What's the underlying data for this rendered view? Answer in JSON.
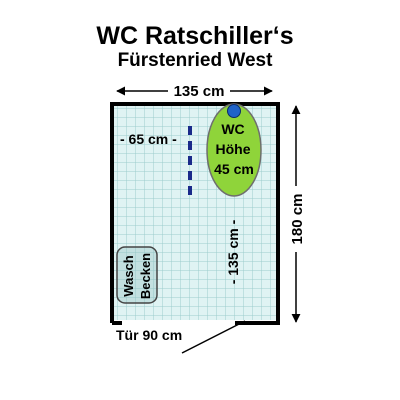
{
  "title": "WC Ratschiller‘s",
  "subtitle": "Fürstenried West",
  "dimensions": {
    "width_label": "135 cm",
    "height_label": "180 cm",
    "inner_width_label": "- 65 cm -",
    "inner_height_label": "- 135 cm -",
    "door_label": "Tür 90 cm"
  },
  "wc": {
    "line1": "WC",
    "line2": "Höhe",
    "line3": "45 cm"
  },
  "sink": {
    "line1": "Wasch",
    "line2": "Becken"
  },
  "colors": {
    "tile": "#dff3f3",
    "grid": "#9ccccc",
    "wall": "#000000",
    "wc_fill": "#8fd43a",
    "handle": "#1a2a8a",
    "flush": "#1f63c8"
  }
}
